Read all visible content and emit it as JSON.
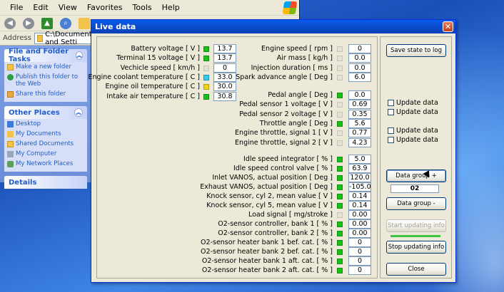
{
  "colors": {
    "title_bar": "#0b4fd1",
    "indicator_green": "#18c018",
    "indicator_cyan": "#38c9f0",
    "indicator_yellow": "#f0d418",
    "task_link": "#215dc6"
  },
  "explorer": {
    "menu": [
      "File",
      "Edit",
      "View",
      "Favorites",
      "Tools",
      "Help"
    ],
    "address_label": "Address",
    "address_value": "C:\\Documents and Setti",
    "file_folder_tasks": {
      "title": "File and Folder Tasks",
      "items": [
        "Make a new folder",
        "Publish this folder to the Web",
        "Share this folder"
      ]
    },
    "other_places": {
      "title": "Other Places",
      "items": [
        "Desktop",
        "My Documents",
        "Shared Documents",
        "My Computer",
        "My Network Places"
      ]
    },
    "details_title": "Details"
  },
  "live": {
    "title": "Live data",
    "close_icon": "close-x-icon",
    "left_column": [
      {
        "label": "Battery voltage [ V ]",
        "indicator": "green",
        "value": "13.7"
      },
      {
        "label": "Terminal 15 voltage [ V ]",
        "indicator": "green",
        "value": "13.7"
      },
      {
        "label": "Vechicle speed [ km/h ]",
        "indicator": "off",
        "value": "0"
      },
      {
        "label": "Engine coolant temperature [ C ]",
        "indicator": "cyan",
        "value": "33.0"
      },
      {
        "label": "Engine oil temperature [ C ]",
        "indicator": "yellow",
        "value": "30.0"
      },
      {
        "label": "Intake air temperature [ C ]",
        "indicator": "green",
        "value": "30.8"
      }
    ],
    "right_column_top": [
      {
        "label": "Engine speed [ rpm ]",
        "indicator": "off",
        "value": "0"
      },
      {
        "label": "Air mass [ kg/h ]",
        "indicator": "off",
        "value": "0.0"
      },
      {
        "label": "Injection duration [ ms ]",
        "indicator": "off",
        "value": "0.0"
      },
      {
        "label": "Spark advance angle [ Deg ]",
        "indicator": "off",
        "value": "6.0"
      }
    ],
    "right_column_mid": [
      {
        "label": "Pedal angle [ Deg ]",
        "indicator": "green",
        "value": "0.0"
      },
      {
        "label": "Pedal sensor 1 voltage [ V ]",
        "indicator": "off",
        "value": "0.69"
      },
      {
        "label": "Pedal sensor 2 voltage [ V ]",
        "indicator": "off",
        "value": "0.35"
      },
      {
        "label": "Throttle angle [ Deg ]",
        "indicator": "green",
        "value": "5.6"
      },
      {
        "label": "Engine throttle, signal 1 [ V ]",
        "indicator": "off",
        "value": "0.77"
      },
      {
        "label": "Engine throttle, signal 2 [ V ]",
        "indicator": "off",
        "value": "4.23"
      }
    ],
    "right_column_bottom": [
      {
        "label": "Idle speed integrator [ % ]",
        "indicator": "green",
        "value": "5.0"
      },
      {
        "label": "Idle speed control valve [ % ]",
        "indicator": "green",
        "value": "63.9"
      },
      {
        "label": "Inlet VANOS, actual position [ Deg ]",
        "indicator": "green",
        "value": "120.0"
      },
      {
        "label": "Exhaust VANOS, actual position [ Deg ]",
        "indicator": "green",
        "value": "-105.0"
      },
      {
        "label": "Knock sensor, cyl 2, mean value [ V ]",
        "indicator": "green",
        "value": "0.14"
      },
      {
        "label": "Knock sensor, cyl 5, mean value [ V ]",
        "indicator": "green",
        "value": "0.14"
      },
      {
        "label": "Load signal [ mg/stroke ]",
        "indicator": "off",
        "value": "0.00"
      },
      {
        "label": "O2-sensor controller, bank 1 [ % ]",
        "indicator": "green",
        "value": "0.00"
      },
      {
        "label": "O2-sensor controller, bank 2 [ % ]",
        "indicator": "green",
        "value": "0.00"
      },
      {
        "label": "O2-sensor heater bank 1 bef. cat. [ % ]",
        "indicator": "green",
        "value": "0"
      },
      {
        "label": "O2-sensor heater bank 2 bef. cat. [ % ]",
        "indicator": "green",
        "value": "0"
      },
      {
        "label": "O2-sensor heater bank 1 aft. cat. [ % ]",
        "indicator": "green",
        "value": "0"
      },
      {
        "label": "O2-sensor heater bank 2 aft. cat. [ % ]",
        "indicator": "green",
        "value": "0"
      }
    ],
    "side": {
      "save_state": "Save state to log",
      "update_data": "Update data",
      "data_group_plus": "Data group +",
      "group_number": "02",
      "data_group_minus": "Data group -",
      "start_updating": "Start updating info",
      "stop_updating": "Stop updating info",
      "close": "Close"
    }
  }
}
